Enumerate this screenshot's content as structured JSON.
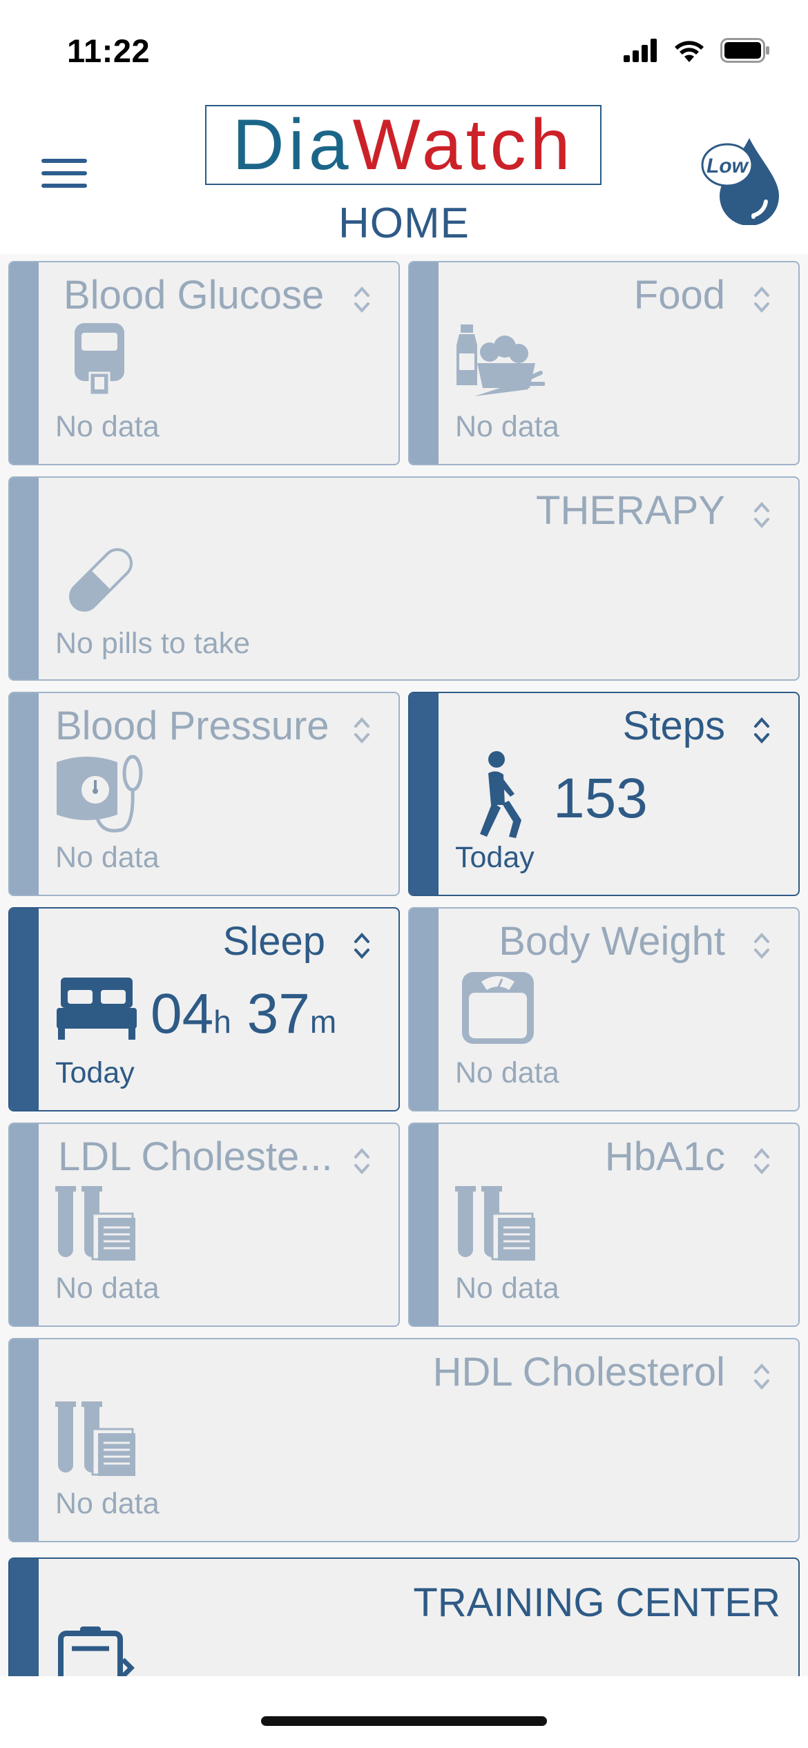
{
  "status": {
    "time": "11:22"
  },
  "header": {
    "logo_part1": "Dia",
    "logo_part2": "Watch",
    "title": "HOME",
    "badge_label": "Low"
  },
  "cards": {
    "blood_glucose": {
      "title": "Blood Glucose",
      "value": "No data"
    },
    "food": {
      "title": "Food",
      "value": "No data"
    },
    "therapy": {
      "title": "THERAPY",
      "value": "No pills to take"
    },
    "blood_pressure": {
      "title": "Blood Pressure",
      "value": "No data"
    },
    "steps": {
      "title": "Steps",
      "value": "153",
      "caption": "Today"
    },
    "sleep": {
      "title": "Sleep",
      "hours": "04",
      "hours_unit": "h",
      "minutes": "37",
      "minutes_unit": "m",
      "caption": "Today"
    },
    "body_weight": {
      "title": "Body Weight",
      "value": "No data"
    },
    "ldl": {
      "title": "LDL Choleste...",
      "value": "No data"
    },
    "hba1c": {
      "title": "HbA1c",
      "value": "No data"
    },
    "hdl": {
      "title": "HDL Cholesterol",
      "value": "No data"
    },
    "training": {
      "title": "TRAINING CENTER"
    }
  },
  "colors": {
    "accent": "#2e5a86",
    "inactive_bar": "#94a9c2",
    "inactive_text": "#98a9bb",
    "logo_blue": "#1b6688",
    "logo_red": "#cc2128"
  }
}
